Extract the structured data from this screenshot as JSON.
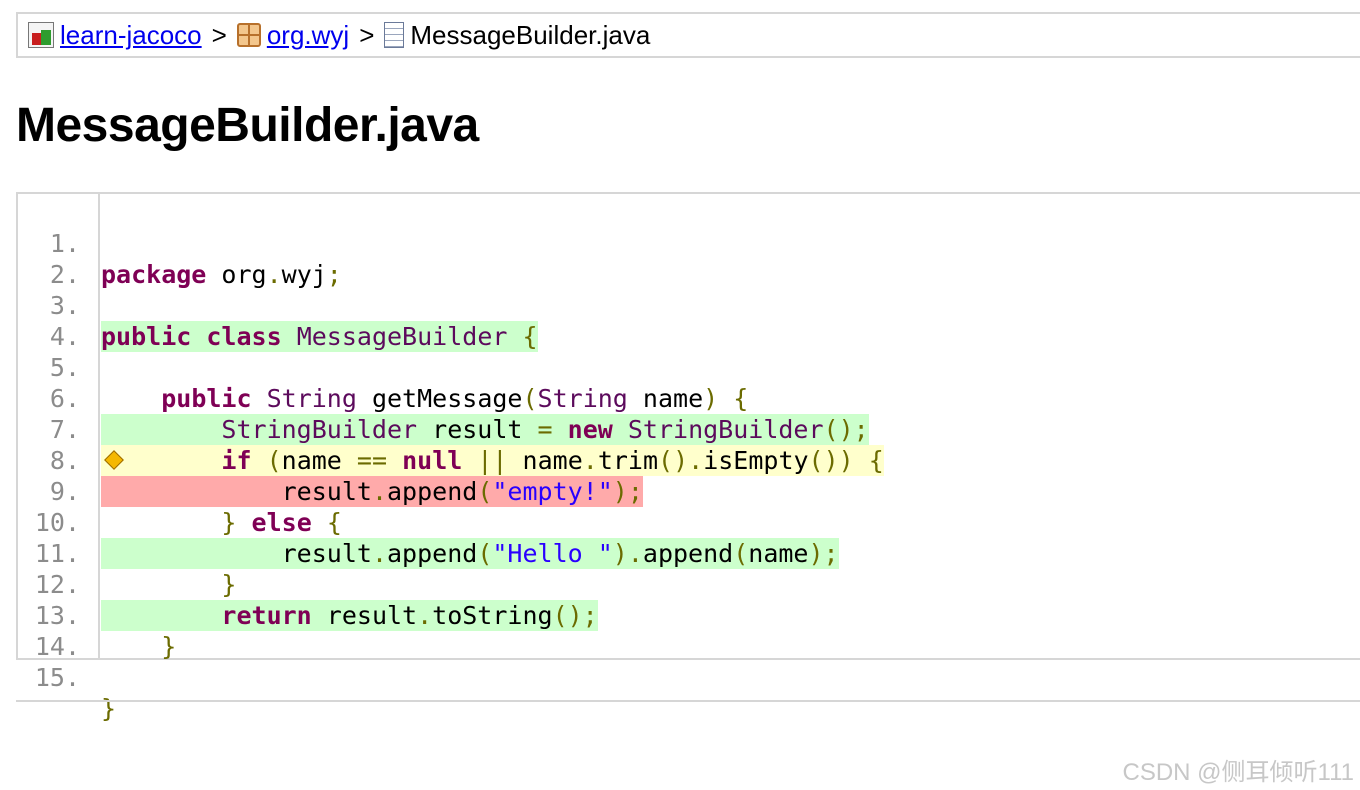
{
  "breadcrumb": {
    "items": [
      {
        "label": "learn-jacoco",
        "icon": "report-icon"
      },
      {
        "label": "org.wyj",
        "icon": "package-icon"
      }
    ],
    "separator": ">",
    "current": {
      "label": "MessageBuilder.java",
      "icon": "java-file-icon"
    }
  },
  "page": {
    "title": "MessageBuilder.java"
  },
  "colors": {
    "fully_covered": "#ccffcc",
    "partly_covered": "#ffffcc",
    "not_covered": "#ffaaaa",
    "link": "#0000ee"
  },
  "source": {
    "line_numbers": [
      "1.",
      "2.",
      "3.",
      "4.",
      "5.",
      "6.",
      "7.",
      "8.",
      "9.",
      "10.",
      "11.",
      "12.",
      "13.",
      "14.",
      "15."
    ],
    "lines": [
      {
        "coverage": "none",
        "text": "package org.wyj;"
      },
      {
        "coverage": "none",
        "text": ""
      },
      {
        "coverage": "full",
        "text": "public class MessageBuilder {"
      },
      {
        "coverage": "none",
        "text": ""
      },
      {
        "coverage": "none",
        "text": "    public String getMessage(String name) {"
      },
      {
        "coverage": "full",
        "text": "        StringBuilder result = new StringBuilder();"
      },
      {
        "coverage": "partial",
        "text": "        if (name == null || name.trim().isEmpty()) {"
      },
      {
        "coverage": "missed",
        "text": "            result.append(\"empty!\");"
      },
      {
        "coverage": "none",
        "text": "        } else {"
      },
      {
        "coverage": "full",
        "text": "            result.append(\"Hello \").append(name);"
      },
      {
        "coverage": "none",
        "text": "        }"
      },
      {
        "coverage": "full",
        "text": "        return result.toString();"
      },
      {
        "coverage": "none",
        "text": "    }"
      },
      {
        "coverage": "none",
        "text": ""
      },
      {
        "coverage": "none",
        "text": "}"
      }
    ]
  },
  "watermark": "CSDN @侧耳倾听111"
}
